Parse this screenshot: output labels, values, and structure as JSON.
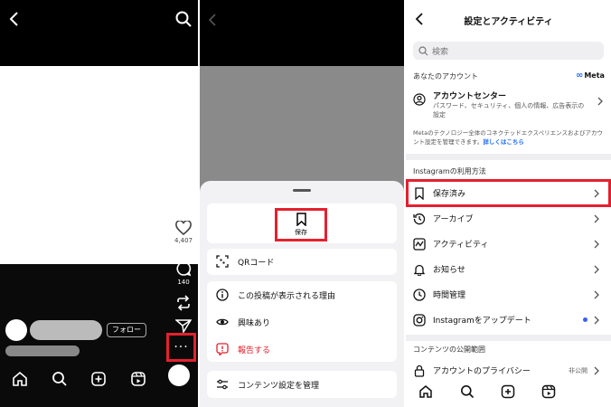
{
  "panel1": {
    "stats": {
      "like_count": "4,407",
      "comment_count": "140"
    },
    "follow_label": "フォロー",
    "more_label": "···"
  },
  "panel2": {
    "save_label": "保存",
    "qr_label": "QRコード",
    "why_label": "この投稿が表示される理由",
    "interested_label": "興味あり",
    "report_label": "報告する",
    "manage_label": "コンテンツ設定を管理"
  },
  "panel3": {
    "title": "設定とアクティビティ",
    "search_placeholder": "検索",
    "account_section": "あなたのアカウント",
    "meta_label": "Meta",
    "account_center": {
      "title": "アカウントセンター",
      "subtitle": "パスワード、セキュリティ、個人の情報、広告表示の設定"
    },
    "meta_note": "Metaのテクノロジー全体のコネクテッドエクスペリエンスおよびアカウント設定を管理できます。",
    "meta_note_link": "詳しくはこちら",
    "usage_section": "Instagramの利用方法",
    "items": [
      {
        "label": "保存済み"
      },
      {
        "label": "アーカイブ"
      },
      {
        "label": "アクティビティ"
      },
      {
        "label": "お知らせ"
      },
      {
        "label": "時間管理"
      },
      {
        "label": "Instagramをアップデート"
      }
    ],
    "visibility_section": "コンテンツの公開範囲",
    "privacy": {
      "label": "アカウントのプライバシー",
      "value": "非公開"
    }
  },
  "colors": {
    "highlight": "#e5202e",
    "link": "#1d6bf2",
    "report": "#e0202e"
  }
}
